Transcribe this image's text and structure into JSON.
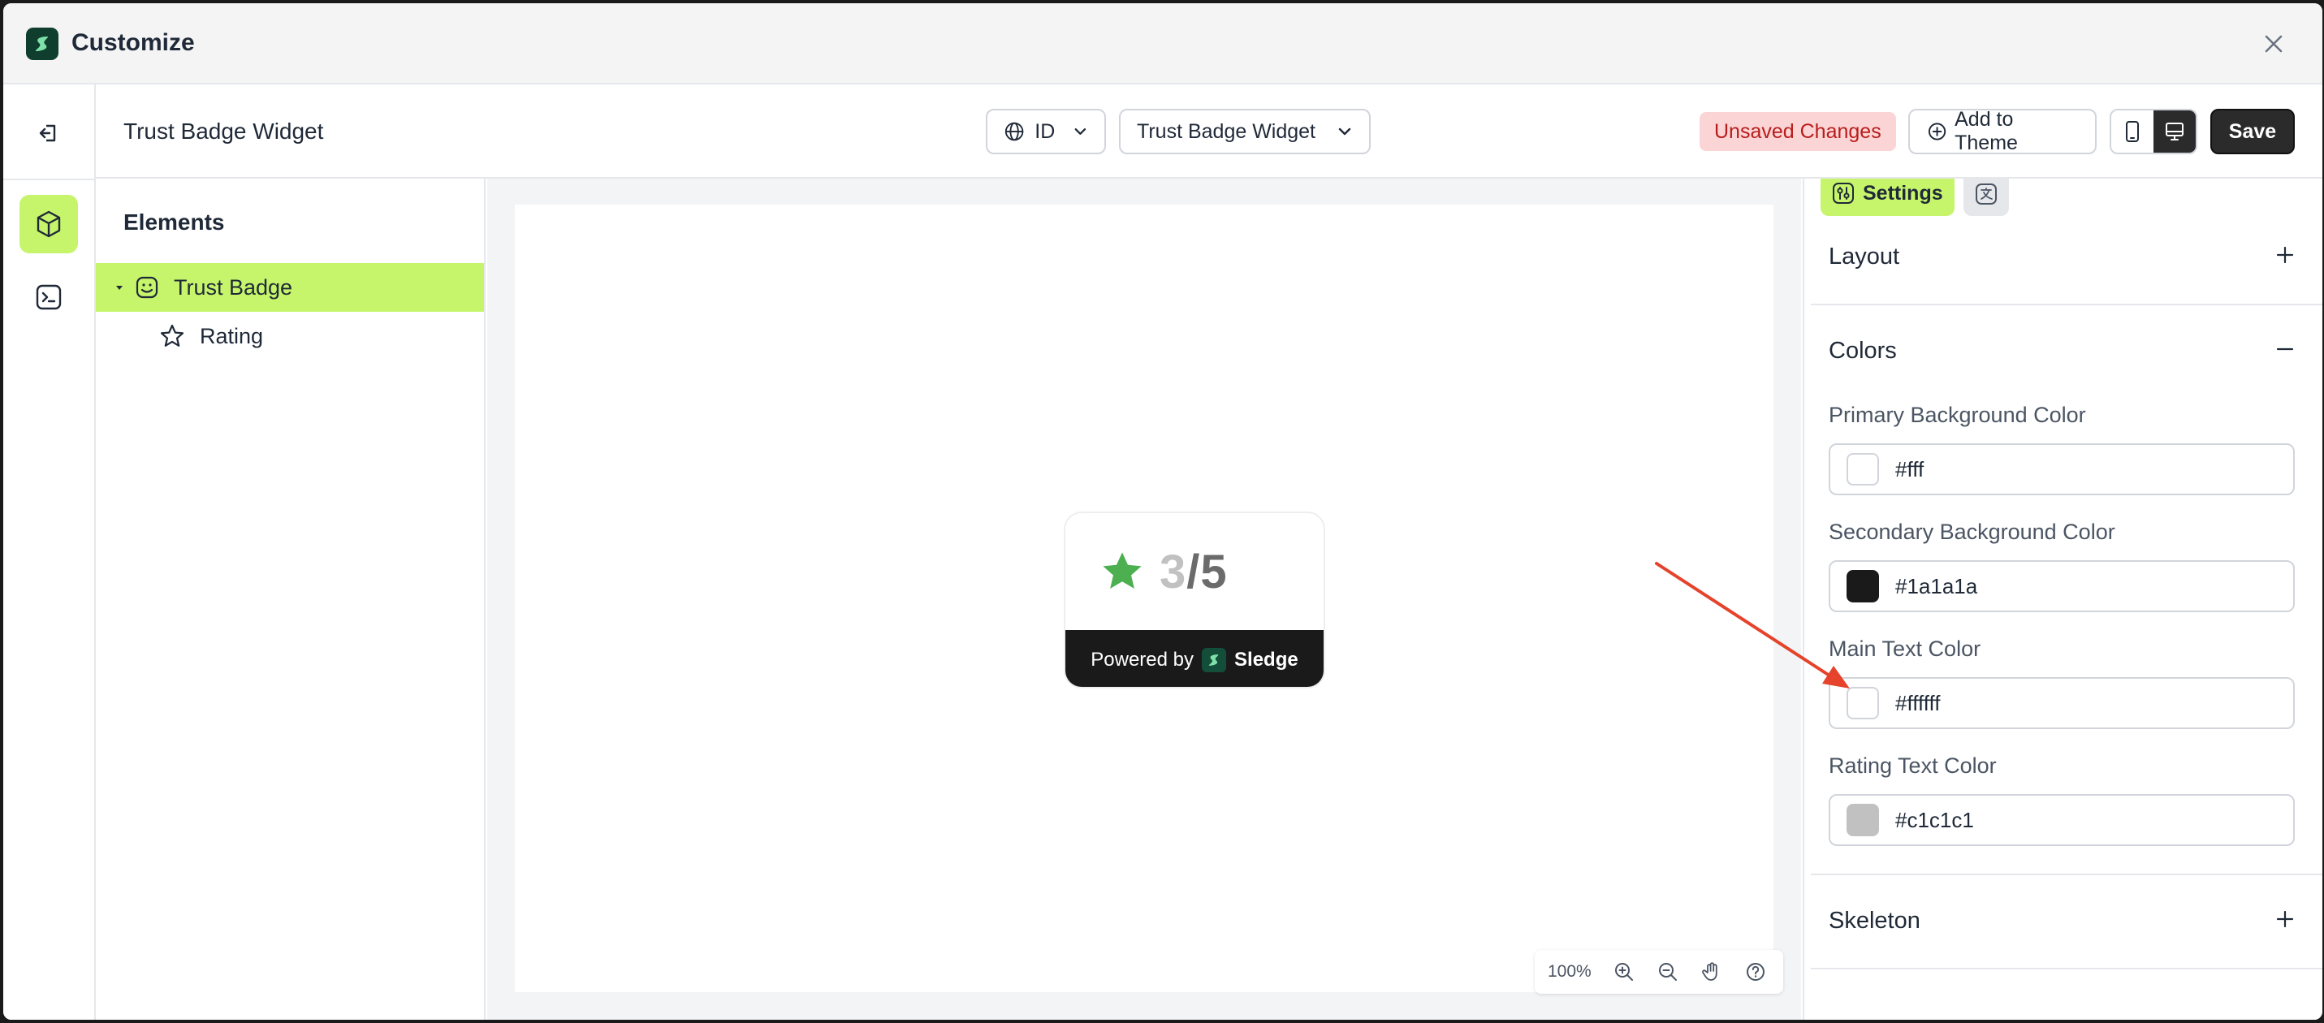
{
  "window": {
    "title": "Customize"
  },
  "header": {
    "title": "Trust Badge Widget",
    "language": "ID",
    "widget_select": "Trust Badge Widget",
    "status_badge": "Unsaved Changes",
    "add_to_theme": "Add to Theme",
    "save": "Save"
  },
  "elements": {
    "title": "Elements",
    "items": [
      {
        "label": "Trust Badge",
        "icon": "badge-icon",
        "active": true
      },
      {
        "label": "Rating",
        "icon": "star-icon",
        "active": false
      }
    ]
  },
  "canvas": {
    "widget": {
      "rating_current": "3",
      "rating_separator": "/",
      "rating_total": "5",
      "powered_by": "Powered by",
      "brand": "Sledge",
      "star_color": "#4caf50"
    },
    "zoom": "100%"
  },
  "settings": {
    "tab_settings": "Settings",
    "sections": {
      "layout": "Layout",
      "colors": "Colors",
      "skeleton": "Skeleton"
    },
    "colors": {
      "primary_bg": {
        "label": "Primary Background Color",
        "value": "#fff",
        "swatch": "#ffffff"
      },
      "secondary_bg": {
        "label": "Secondary Background Color",
        "value": "#1a1a1a",
        "swatch": "#1a1a1a"
      },
      "main_text": {
        "label": "Main Text Color",
        "value": "#ffffff",
        "swatch": "#ffffff"
      },
      "rating_text": {
        "label": "Rating Text Color",
        "value": "#c1c1c1",
        "swatch": "#c1c1c1"
      }
    }
  },
  "theme": {
    "accent": "#c6f56b",
    "dark": "#2b2b2b",
    "annotation_arrow": "#e5432b"
  }
}
